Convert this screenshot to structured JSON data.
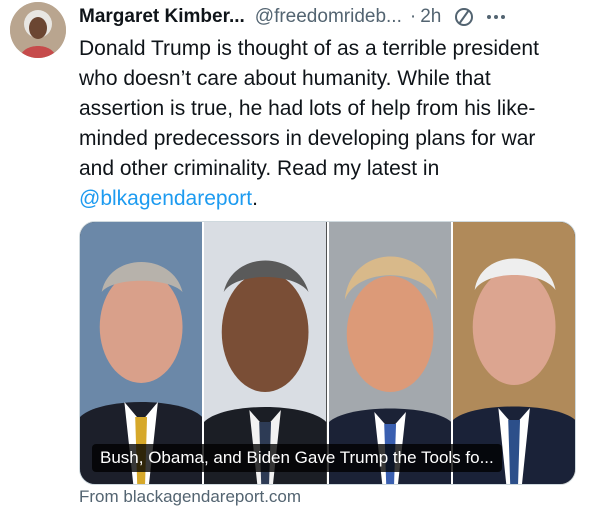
{
  "tweet": {
    "author_name": "Margaret Kimber...",
    "author_handle": "@freedomrideb...",
    "separator": "·",
    "time": "2h",
    "text_lines": [
      "Donald Trump is thought of as a terrible president",
      "who doesn’t care about humanity. While that",
      "assertion is true, he had lots of help from his like-",
      "minded predecessors in developing plans for war",
      "and other criminality. Read my latest in"
    ],
    "mention": "@blkagendareport",
    "mention_suffix": "."
  },
  "card": {
    "caption": "Bush, Obama, and Biden Gave Trump the Tools fo...",
    "source": "From blackagendareport.com"
  },
  "icons": {
    "grok": "slashed-circle-icon",
    "more": "more-horizontal-icon"
  },
  "colors": {
    "link": "#1d9bf0",
    "secondary_text": "#536471",
    "primary_text": "#0f1419"
  }
}
